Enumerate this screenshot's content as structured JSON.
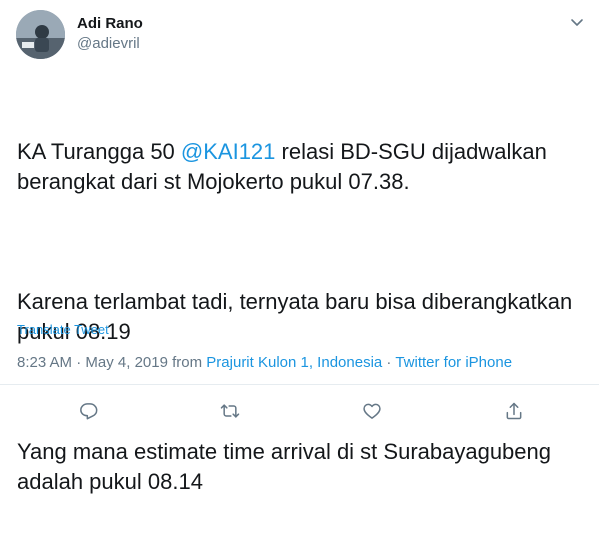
{
  "author": {
    "name": "Adi Rano",
    "handle": "@adievril"
  },
  "tweet": {
    "line1_prefix": "KA Turangga 50 ",
    "mention": "@KAI121",
    "line1_suffix": " relasi BD-SGU dijadwalkan berangkat dari st Mojokerto pukul 07.38.",
    "para2": "Karena terlambat tadi, ternyata baru bisa diberangkatkan pukul 08.19",
    "para3": "Yang mana estimate time arrival di st Surabayagubeng adalah pukul 08.14"
  },
  "translate_label": "Translate Tweet",
  "meta": {
    "time": "8:23 AM",
    "sep1": " · ",
    "date": "May 4, 2019",
    "from": " from ",
    "location": "Prajurit Kulon 1, Indonesia",
    "sep2": " · ",
    "source": "Twitter for iPhone"
  },
  "actions": [
    "reply-icon",
    "retweet-icon",
    "like-icon",
    "share-icon"
  ],
  "colors": {
    "link": "#1b95e0",
    "secondary": "#657786",
    "text": "#14171a",
    "divider": "#e6ecf0"
  }
}
